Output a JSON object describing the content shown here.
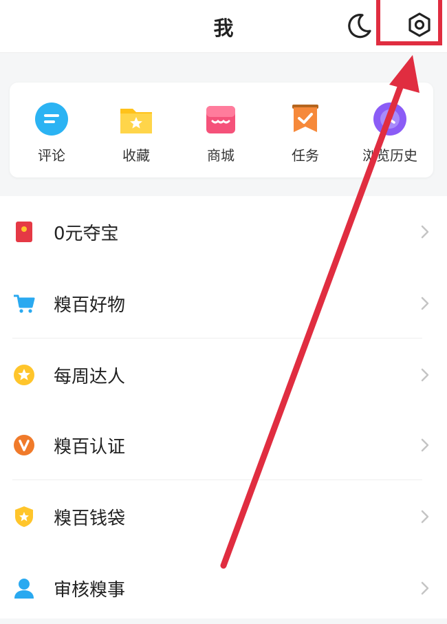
{
  "header": {
    "title": "我"
  },
  "icons": {
    "moon": "moon-icon",
    "settings": "gear-icon"
  },
  "quick_actions": [
    {
      "label": "评论",
      "icon": "comment-icon",
      "color": "#2bb3f3"
    },
    {
      "label": "收藏",
      "icon": "folder-star-icon",
      "color": "#ffc21a"
    },
    {
      "label": "商城",
      "icon": "store-icon",
      "color": "#f5527a"
    },
    {
      "label": "任务",
      "icon": "task-badge-icon",
      "color": "#f6893a"
    },
    {
      "label": "浏览历史",
      "icon": "history-icon",
      "color": "#8b5cf6"
    }
  ],
  "menu": [
    {
      "label": "0元夺宝",
      "icon": "red-envelope-icon",
      "color": "#e53945"
    },
    {
      "label": "糗百好物",
      "icon": "cart-icon",
      "color": "#2aa9f0"
    },
    {
      "label": "每周达人",
      "icon": "star-badge-icon",
      "color": "#ffc52b"
    },
    {
      "label": "糗百认证",
      "icon": "verified-v-icon",
      "color": "#f07a2a"
    },
    {
      "label": "糗百钱袋",
      "icon": "shield-star-icon",
      "color": "#ffc52b"
    },
    {
      "label": "审核糗事",
      "icon": "user-icon",
      "color": "#2aa9f0"
    }
  ],
  "annotation": {
    "color": "#e02d40"
  }
}
